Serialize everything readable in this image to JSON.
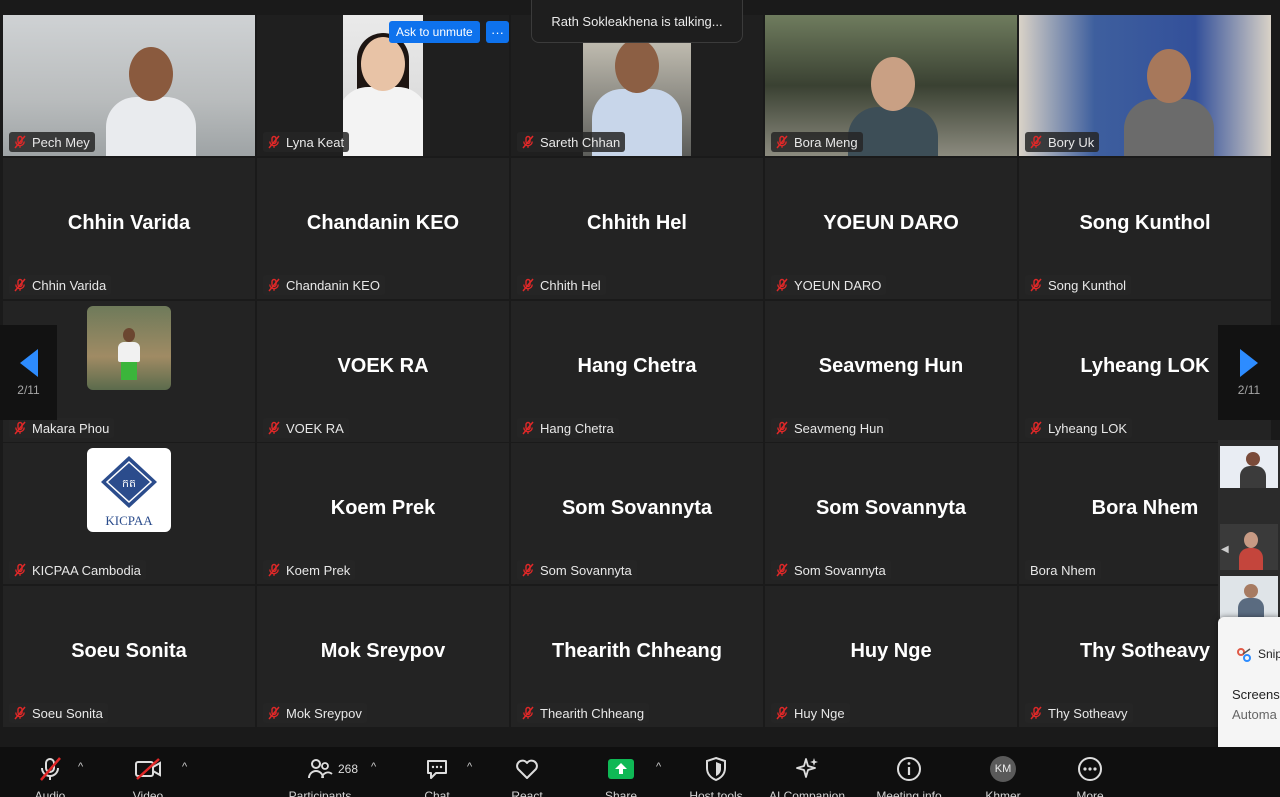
{
  "toast": {
    "text": "Rath Sokleakhena is talking..."
  },
  "ask_unmute": {
    "label": "Ask to unmute",
    "more": "···"
  },
  "pager": {
    "left_page": "2/11",
    "right_page": "2/11"
  },
  "tiles": [
    {
      "label": "Pech Mey"
    },
    {
      "label": "Lyna Keat"
    },
    {
      "label": "Sareth Chhan"
    },
    {
      "label": "Bora Meng"
    },
    {
      "label": "Bory Uk"
    },
    {
      "big": "Chhin Varida",
      "label": "Chhin Varida"
    },
    {
      "big": "Chandanin KEO",
      "label": "Chandanin KEO"
    },
    {
      "big": "Chhith Hel",
      "label": "Chhith Hel"
    },
    {
      "big": "YOEUN DARO",
      "label": "YOEUN DARO"
    },
    {
      "big": "Song Kunthol",
      "label": "Song Kunthol"
    },
    {
      "label": "Makara Phou"
    },
    {
      "big": "VOEK RA",
      "label": "VOEK RA"
    },
    {
      "big": "Hang Chetra",
      "label": "Hang Chetra"
    },
    {
      "big": "Seavmeng Hun",
      "label": "Seavmeng Hun"
    },
    {
      "big": "Lyheang LOK",
      "label": "Lyheang LOK"
    },
    {
      "label": "KICPAA Cambodia",
      "logo_text": "KICPAA"
    },
    {
      "big": "Koem Prek",
      "label": "Koem Prek"
    },
    {
      "big": "Som Sovannyta",
      "label": "Som Sovannyta"
    },
    {
      "big": "Som Sovannyta",
      "label": "Som Sovannyta"
    },
    {
      "big": "Bora Nhem",
      "label": "Bora Nhem"
    },
    {
      "big": "Soeu Sonita",
      "label": "Soeu Sonita"
    },
    {
      "big": "Mok Sreypov",
      "label": "Mok Sreypov"
    },
    {
      "big": "Thearith Chheang",
      "label": "Thearith Chheang"
    },
    {
      "big": "Huy Nge",
      "label": "Huy Nge"
    },
    {
      "big": "Thy Sotheavy",
      "label": "Thy Sotheavy"
    }
  ],
  "toolbar": {
    "audio": "Audio",
    "video": "Video",
    "participants": "Participants",
    "participants_count": "268",
    "chat": "Chat",
    "react": "React",
    "share": "Share",
    "host_tools": "Host tools",
    "ai_companion": "AI Companion",
    "meeting_info": "Meeting info",
    "khmer": "Khmer",
    "khmer_initials": "KM",
    "more": "More"
  },
  "snip": {
    "title": "Snip",
    "line1": "Screens",
    "line2": "Automa"
  },
  "colors": {
    "accent_blue": "#0e72ed",
    "arrow_blue": "#2d8cff",
    "mic_red": "#e02828",
    "share_green": "#0fb855"
  }
}
